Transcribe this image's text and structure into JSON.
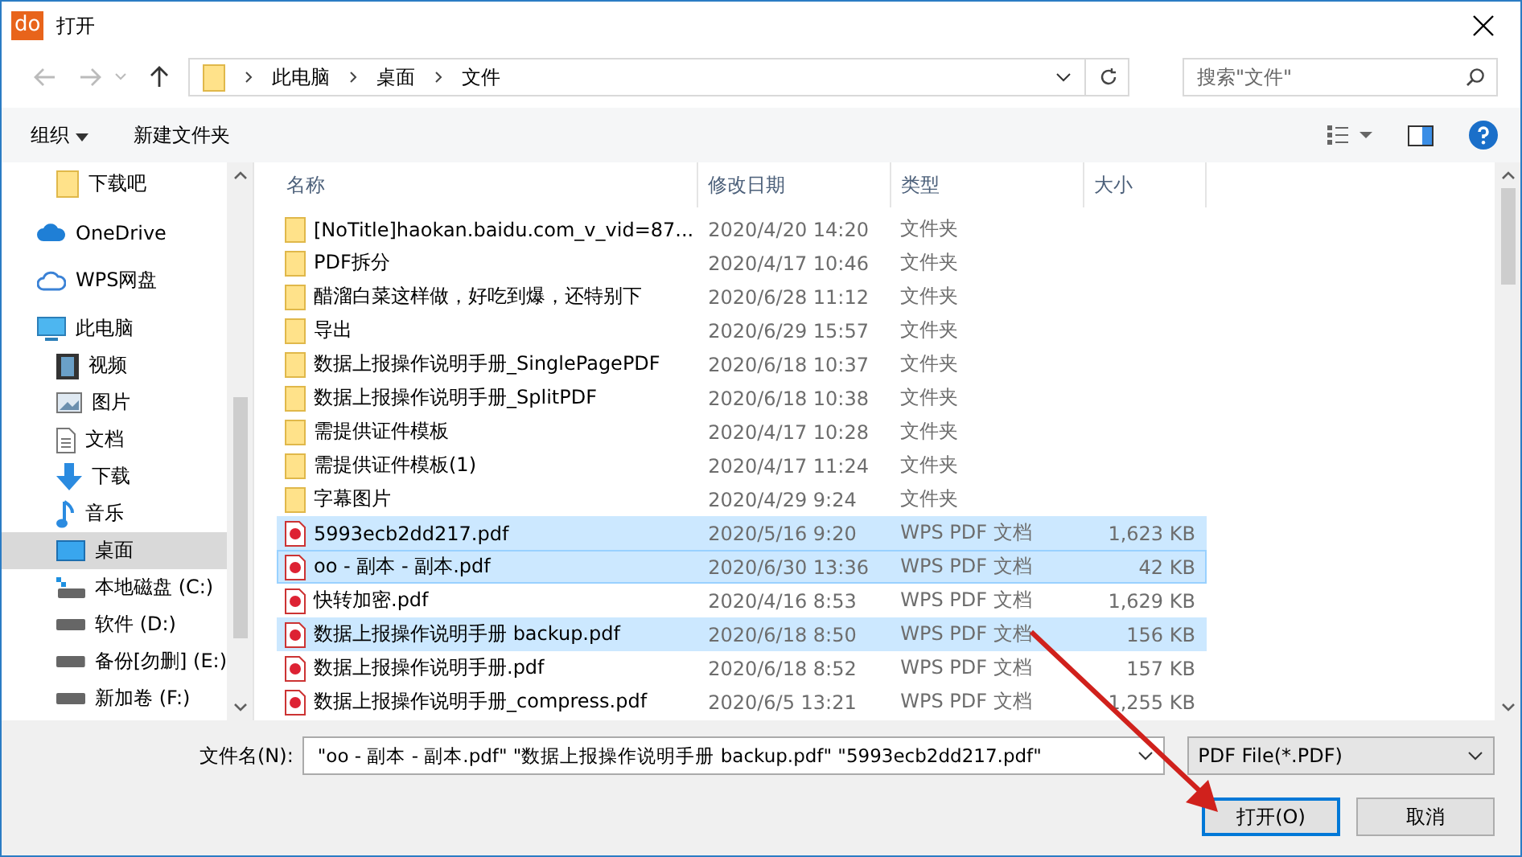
{
  "window": {
    "title": "打开",
    "app_icon": "do"
  },
  "address": {
    "path": [
      "此电脑",
      "桌面",
      "文件"
    ]
  },
  "search": {
    "placeholder": "搜索\"文件\""
  },
  "toolbar": {
    "organize": "组织",
    "new_folder": "新建文件夹"
  },
  "sidebar": {
    "items": [
      {
        "label": "下载吧",
        "kind": "folder",
        "selected": false
      },
      {
        "label": "OneDrive",
        "kind": "cloud",
        "selected": false
      },
      {
        "label": "WPS网盘",
        "kind": "cloud-outline",
        "selected": false
      },
      {
        "label": "此电脑",
        "kind": "pc",
        "selected": false
      },
      {
        "label": "视频",
        "kind": "video",
        "selected": false
      },
      {
        "label": "图片",
        "kind": "picture",
        "selected": false
      },
      {
        "label": "文档",
        "kind": "doc",
        "selected": false
      },
      {
        "label": "下载",
        "kind": "download",
        "selected": false
      },
      {
        "label": "音乐",
        "kind": "music",
        "selected": false
      },
      {
        "label": "桌面",
        "kind": "desktop",
        "selected": true
      },
      {
        "label": "本地磁盘 (C:)",
        "kind": "system-drive",
        "selected": false
      },
      {
        "label": "软件 (D:)",
        "kind": "drive",
        "selected": false
      },
      {
        "label": "备份[勿删] (E:)",
        "kind": "drive",
        "selected": false
      },
      {
        "label": "新加卷 (F:)",
        "kind": "drive",
        "selected": false
      }
    ]
  },
  "table": {
    "columns": [
      "名称",
      "修改日期",
      "类型",
      "大小"
    ],
    "rows": [
      {
        "name": "[NoTitle]haokan.baidu.com_v_vid=87...",
        "date": "2020/4/20 14:20",
        "type": "文件夹",
        "kind": "folder",
        "selected": false
      },
      {
        "name": "PDF拆分",
        "date": "2020/4/17 10:46",
        "type": "文件夹",
        "kind": "folder",
        "selected": false
      },
      {
        "name": "醋溜白菜这样做，好吃到爆，还特别下",
        "date": "2020/6/28 11:12",
        "type": "文件夹",
        "kind": "folder",
        "selected": false
      },
      {
        "name": "导出",
        "date": "2020/6/29 15:57",
        "type": "文件夹",
        "kind": "folder",
        "selected": false
      },
      {
        "name": "数据上报操作说明手册_SinglePagePDF",
        "date": "2020/6/18 10:37",
        "type": "文件夹",
        "kind": "folder",
        "selected": false
      },
      {
        "name": "数据上报操作说明手册_SplitPDF",
        "date": "2020/6/18 10:38",
        "type": "文件夹",
        "kind": "folder",
        "selected": false
      },
      {
        "name": "需提供证件模板",
        "date": "2020/4/17 10:28",
        "type": "文件夹",
        "kind": "folder",
        "selected": false
      },
      {
        "name": "需提供证件模板(1)",
        "date": "2020/4/17 11:24",
        "type": "文件夹",
        "kind": "folder",
        "selected": false
      },
      {
        "name": "字幕图片",
        "date": "2020/4/29 9:24",
        "type": "文件夹",
        "kind": "folder",
        "selected": false
      },
      {
        "name": "5993ecb2dd217.pdf",
        "date": "2020/5/16 9:20",
        "type": "WPS PDF 文档",
        "size": "1,623 KB",
        "kind": "pdf",
        "selected": true
      },
      {
        "name": "oo - 副本 - 副本.pdf",
        "date": "2020/6/30 13:36",
        "type": "WPS PDF 文档",
        "size": "42 KB",
        "kind": "pdf",
        "selected": true
      },
      {
        "name": "快转加密.pdf",
        "date": "2020/4/16 8:53",
        "type": "WPS PDF 文档",
        "size": "1,629 KB",
        "kind": "pdf",
        "selected": false
      },
      {
        "name": "数据上报操作说明手册 backup.pdf",
        "date": "2020/6/18 8:50",
        "type": "WPS PDF 文档",
        "size": "156 KB",
        "kind": "pdf",
        "selected": true
      },
      {
        "name": "数据上报操作说明手册.pdf",
        "date": "2020/6/18 8:52",
        "type": "WPS PDF 文档",
        "size": "157 KB",
        "kind": "pdf",
        "selected": false
      },
      {
        "name": "数据上报操作说明手册_compress.pdf",
        "date": "2020/6/5 13:21",
        "type": "WPS PDF 文档",
        "size": "1,255 KB",
        "kind": "pdf",
        "selected": false
      }
    ]
  },
  "footer": {
    "filename_label": "文件名(N):",
    "filename_value": "\"oo - 副本 - 副本.pdf\" \"数据上报操作说明手册 backup.pdf\" \"5993ecb2dd217.pdf\"",
    "filter": "PDF File(*.PDF)",
    "open_button": "打开(O)",
    "cancel_button": "取消"
  }
}
